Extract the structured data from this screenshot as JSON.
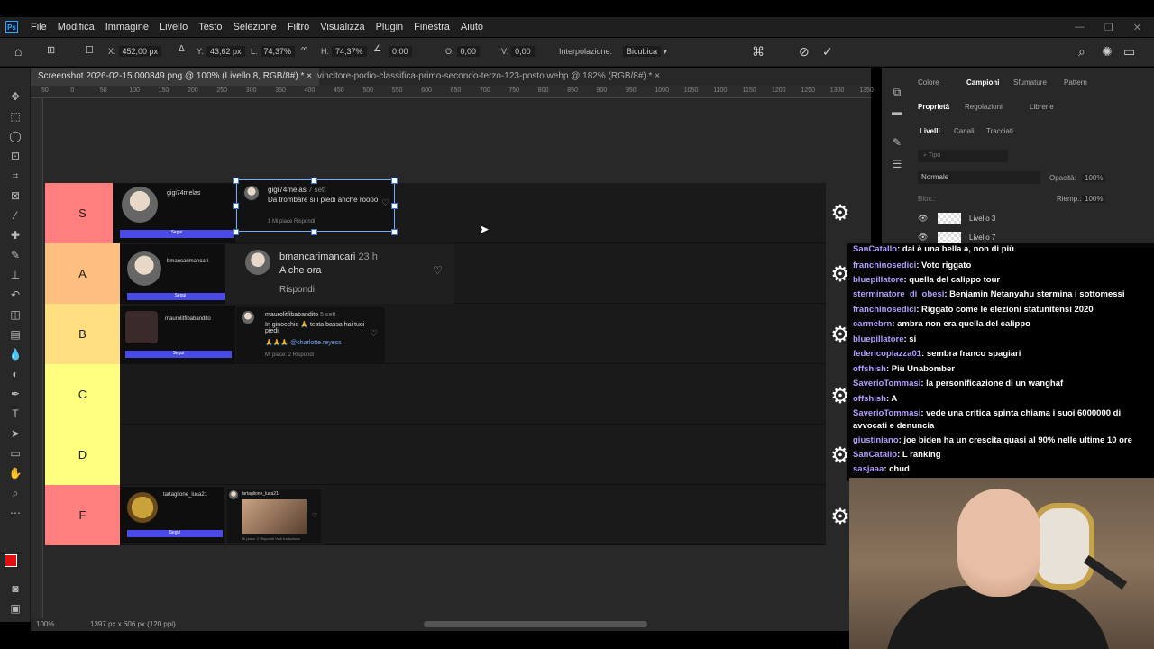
{
  "menu": {
    "logo": "Ps",
    "items": [
      "File",
      "Modifica",
      "Immagine",
      "Livello",
      "Testo",
      "Selezione",
      "Filtro",
      "Visualizza",
      "Plugin",
      "Finestra",
      "Aiuto"
    ],
    "window_controls": [
      "—",
      "❐",
      "✕"
    ]
  },
  "options": {
    "x_label": "X:",
    "x_value": "452,00 px",
    "y_label": "Y:",
    "y_value": "43,62 px",
    "w_label": "L:",
    "w_value": "74,37%",
    "h_label": "H:",
    "h_value": "74,37%",
    "rot_value": "0,00",
    "h_skew_label": "O:",
    "h_skew_value": "0,00",
    "v_skew_label": "V:",
    "v_skew_value": "0,00",
    "interp_label": "Interpolazione:",
    "interp_value": "Bicubica"
  },
  "tabs": [
    {
      "label": "Screenshot 2026-02-15 000849.png @ 100% (Livello 8, RGB/8#) *",
      "close": "×"
    },
    {
      "label": "vincitore-podio-classifica-primo-secondo-terzo-123-posto.webp @ 182% (RGB/8#) *",
      "close": "×"
    }
  ],
  "ruler_ticks": [
    "50",
    "0",
    "50",
    "100",
    "150",
    "200",
    "250",
    "300",
    "350",
    "400",
    "450",
    "500",
    "550",
    "600",
    "650",
    "700",
    "750",
    "800",
    "850",
    "900",
    "950",
    "1000",
    "1050",
    "1100",
    "1150",
    "1200",
    "1250",
    "1300",
    "1350"
  ],
  "tiers": [
    {
      "label": "S",
      "color": "#ff7f7f"
    },
    {
      "label": "A",
      "color": "#ffbf7f"
    },
    {
      "label": "B",
      "color": "#ffdf7f"
    },
    {
      "label": "C",
      "color": "#ffff7f"
    },
    {
      "label": "D",
      "color": "#ffff7f"
    },
    {
      "label": "F",
      "color": "#ff7f7f"
    }
  ],
  "cards": {
    "s_profile_name": "gigi74melas",
    "s_comment_user": "gigi74melas",
    "s_comment_time": "7 sett",
    "s_comment_text": "Da trombare si i piedi anche roooo",
    "s_comment_meta": "1 Mi piace   Rispondi",
    "a_profile_name": "bmancarimancari",
    "a_comment_user": "bmancarimancari",
    "a_comment_time": "23 h",
    "a_comment_text": "A che ora",
    "a_comment_reply": "Rispondi",
    "b_profile_name": "maurolitfibabandito",
    "b_comment_user": "maurolitfibabandito",
    "b_comment_time": "5 sett",
    "b_comment_text": "In ginocchio 🙏 testa bassa hai tuoi piedi",
    "b_comment_mention": "🙏🙏🙏 @charlotte.reyess",
    "b_comment_meta": "Mi piace: 2   Rispondi",
    "f_profile_name": "tartaglione_luca21",
    "f_comment_user": "tartaglione_luca21",
    "f_comment_meta": "Mi piace: 2   Rispondi   Vedi traduzione",
    "follow_label": "Segui"
  },
  "status": {
    "zoom": "100%",
    "doc_info": "1397 px x 606 px (120 ppi)"
  },
  "right_panel": {
    "tabs_top": [
      "Colore",
      "Campioni",
      "Sfumature",
      "Pattern"
    ],
    "tabs_mid": [
      "Proprietà",
      "Regolazioni",
      "Librerie"
    ],
    "tabs_layers": [
      "Livelli",
      "Canali",
      "Tracciati"
    ],
    "search_placeholder": "Tipo",
    "blend_mode": "Normale",
    "opacity_label": "Opacità:",
    "opacity_value": "100%",
    "lock_label": "Bloc.:",
    "fill_label": "Riemp.:",
    "fill_value": "100%",
    "layers": [
      "Livello 3",
      "Livello 7"
    ]
  },
  "chat": [
    {
      "user": "SanCatallo",
      "text": ": dai è una bella a, non di più"
    },
    {
      "user": "franchinosedici",
      "text": ": Voto riggato"
    },
    {
      "user": "bluepillatore",
      "text": ": quella del calippo tour"
    },
    {
      "user": "sterminatore_di_obesi",
      "text": ": Benjamin Netanyahu stermina i sottomessi"
    },
    {
      "user": "franchinosedici",
      "text": ": Riggato come le elezioni statunitensi 2020"
    },
    {
      "user": "carmebrn",
      "text": ": ambra non era quella del calippo"
    },
    {
      "user": "bluepillatore",
      "text": ": si"
    },
    {
      "user": "federicopiazza01",
      "text": ": sembra franco spagiari"
    },
    {
      "user": "offshish",
      "text": ": Più Unabomber"
    },
    {
      "user": "SaverioTommasi",
      "text": ": la personificazione di un wanghaf"
    },
    {
      "user": "offshish",
      "text": ": A"
    },
    {
      "user": "SaverioTommasi",
      "text": ": vede una critica spinta chiama i suoi 6000000 di avvocati e denuncia"
    },
    {
      "user": "giustiniano",
      "text": ": joe biden ha un crescita quasi al 90% nelle ultime 10 ore"
    },
    {
      "user": "SanCatallo",
      "text": ": L ranking"
    },
    {
      "user": "sasjaaa",
      "text": ": chud"
    }
  ],
  "colors": {
    "accent": "#31a8ff",
    "chat_user": "#b39dff",
    "foreground_swatch": "#e01010",
    "follow_button": "#4a4ae8"
  }
}
